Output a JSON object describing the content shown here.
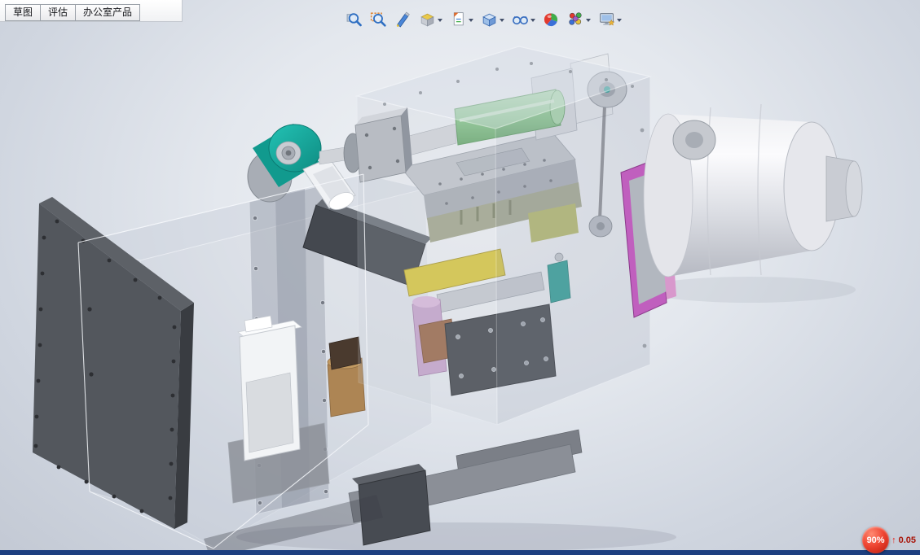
{
  "command_tabs": {
    "items": [
      {
        "label": "草图"
      },
      {
        "label": "评估"
      },
      {
        "label": "办公室产品"
      }
    ]
  },
  "heads_up_toolbar": {
    "buttons": [
      {
        "name": "zoom-to-fit",
        "has_dropdown": false
      },
      {
        "name": "zoom-to-area",
        "has_dropdown": false
      },
      {
        "name": "previous-view",
        "has_dropdown": false
      },
      {
        "name": "section-view",
        "has_dropdown": true
      },
      {
        "name": "dynamic-annotation-views",
        "has_dropdown": true
      },
      {
        "name": "view-orientation",
        "has_dropdown": true
      },
      {
        "name": "hide-show-items",
        "has_dropdown": true
      },
      {
        "name": "edit-appearance",
        "has_dropdown": false
      },
      {
        "name": "apply-scene",
        "has_dropdown": true
      },
      {
        "name": "view-settings",
        "has_dropdown": true
      }
    ]
  },
  "performance_indicator": {
    "badge_value": "90%",
    "arrow_glyph": "↑",
    "delta_value": "0.05"
  },
  "colors": {
    "background_center": "#f1f3f6",
    "background_edge": "#c3c9d4",
    "status_bar_blue": "#1d3f80",
    "badge_red": "#e03225",
    "model_teal": "#17ada0",
    "model_green": "#8cc98f",
    "model_magenta": "#c05fbe",
    "model_yellow": "#d9c73e"
  }
}
